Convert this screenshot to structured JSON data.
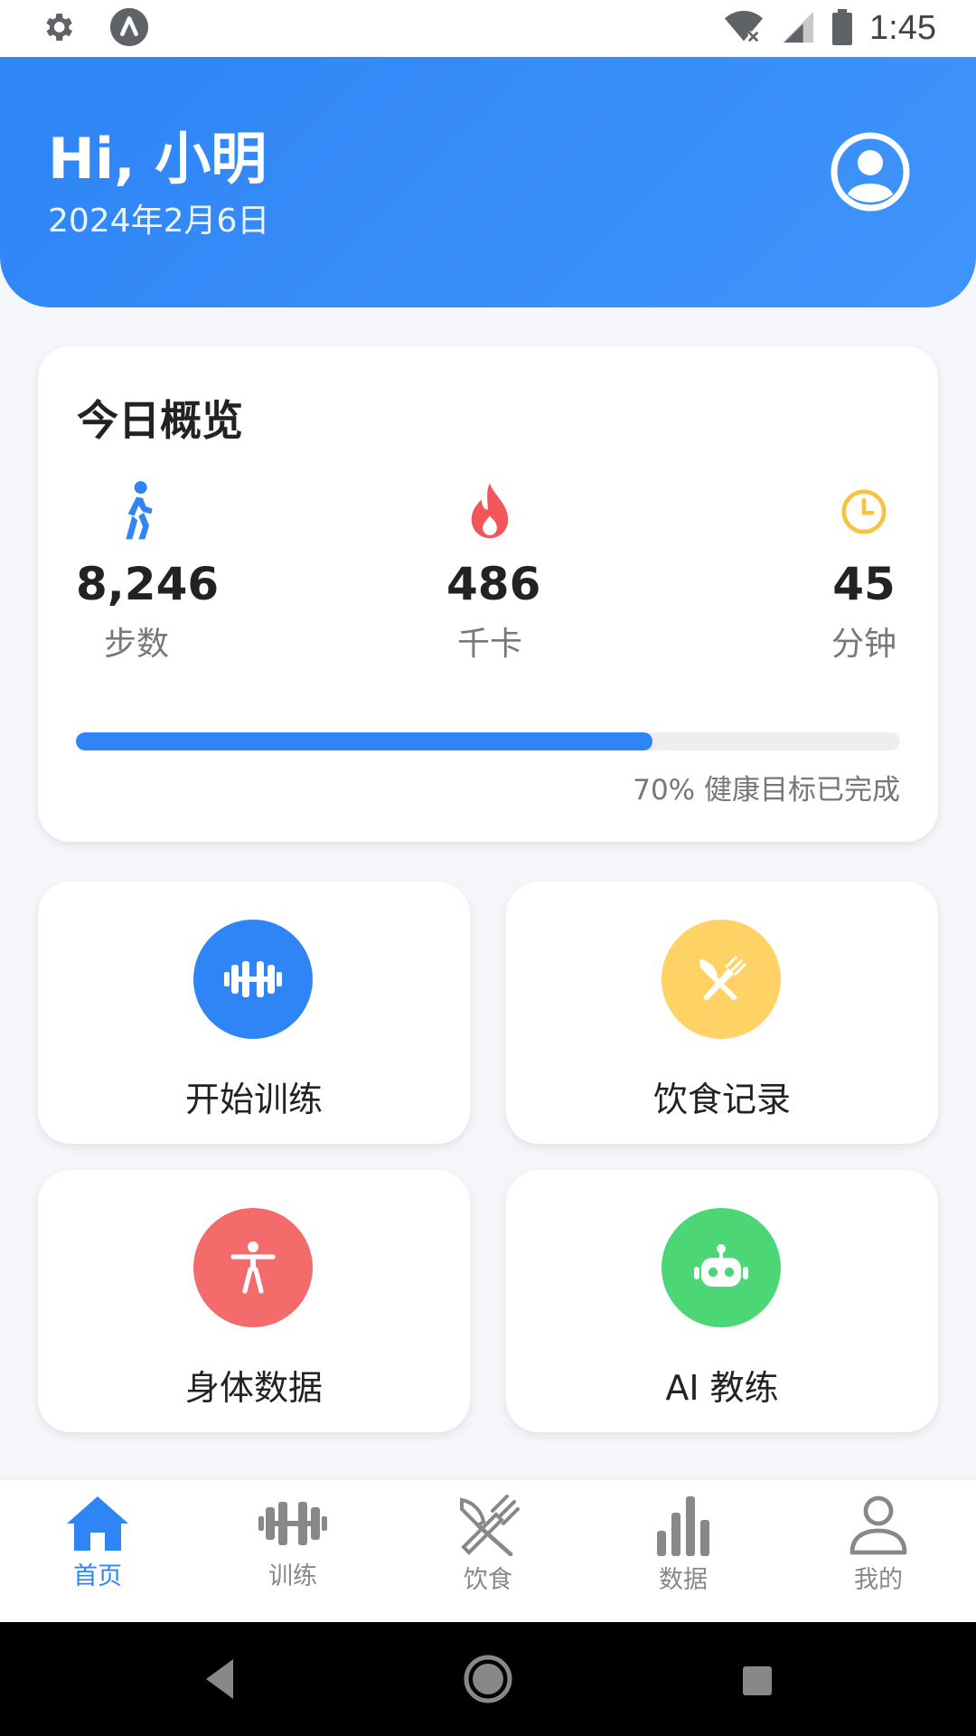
{
  "status_bar": {
    "time": "1:45",
    "icons": [
      "settings-gear-icon",
      "app-notification-icon",
      "wifi-off-icon",
      "cell-signal-icon",
      "battery-icon"
    ]
  },
  "header": {
    "greeting": "Hi, 小明",
    "date": "2024年2月6日",
    "avatar_icon": "user-circle-icon"
  },
  "overview": {
    "title": "今日概览",
    "stats": [
      {
        "icon": "walking-icon",
        "value": "8,246",
        "label": "步数",
        "color": "#2f84f6"
      },
      {
        "icon": "flame-icon",
        "value": "486",
        "label": "千卡",
        "color": "#f2555a"
      },
      {
        "icon": "clock-icon",
        "value": "45",
        "label": "分钟",
        "color": "#f5c443"
      }
    ],
    "progress_percent": 70,
    "progress_text": "70% 健康目标已完成"
  },
  "tiles": [
    {
      "label": "开始训练",
      "icon": "dumbbell-icon",
      "color": "#2f84f6"
    },
    {
      "label": "饮食记录",
      "icon": "fork-knife-icon",
      "color": "#ffd266"
    },
    {
      "label": "身体数据",
      "icon": "body-icon",
      "color": "#f46b6b"
    },
    {
      "label": "AI 教练",
      "icon": "robot-icon",
      "color": "#4cd675"
    }
  ],
  "bottom_nav": [
    {
      "label": "首页",
      "icon": "home-icon",
      "active": true
    },
    {
      "label": "训练",
      "icon": "dumbbell-icon",
      "active": false
    },
    {
      "label": "饮食",
      "icon": "fork-knife-icon",
      "active": false
    },
    {
      "label": "数据",
      "icon": "bar-chart-icon",
      "active": false
    },
    {
      "label": "我的",
      "icon": "person-icon",
      "active": false
    }
  ],
  "colors": {
    "primary": "#2f84f6",
    "background": "#f4f6fa"
  }
}
